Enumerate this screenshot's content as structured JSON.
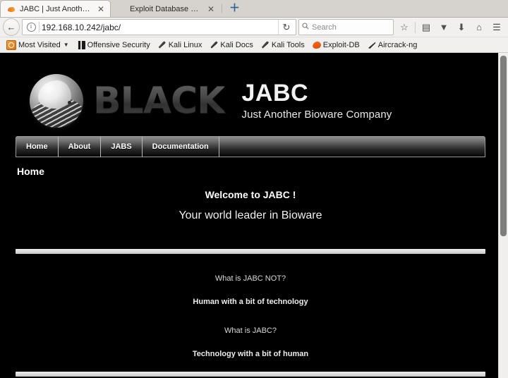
{
  "browser": {
    "tabs": [
      {
        "title": "JABC | Just Another ...",
        "icon": "firefox-globe-icon",
        "active": true,
        "close_label": "✕"
      },
      {
        "title": "Exploit Database Sear...",
        "icon": "exploit-db-icon",
        "active": false,
        "close_label": "✕"
      }
    ],
    "new_tab_label": "＋",
    "back_label": "←",
    "identity_label": "i",
    "url": "192.168.10.242/jabc/",
    "reload_label": "↻",
    "search_placeholder": "Search",
    "search_icon": "🔍",
    "toolbar_icons": [
      {
        "name": "bookmark-star-icon",
        "glyph": "☆"
      },
      {
        "name": "reader-view-icon",
        "glyph": "▤"
      },
      {
        "name": "pocket-icon",
        "glyph": "▼"
      },
      {
        "name": "downloads-icon",
        "glyph": "⬇"
      },
      {
        "name": "home-icon",
        "glyph": "⌂"
      },
      {
        "name": "menu-hamburger-icon",
        "glyph": "☰"
      }
    ],
    "bookmarks": [
      {
        "label": "Most Visited",
        "icon": "most-visited-icon",
        "has_caret": true
      },
      {
        "label": "Offensive Security",
        "icon": "offensive-security-icon",
        "has_caret": false
      },
      {
        "label": "Kali Linux",
        "icon": "kali-dragon-icon",
        "has_caret": false
      },
      {
        "label": "Kali Docs",
        "icon": "kali-dragon-icon",
        "has_caret": false
      },
      {
        "label": "Kali Tools",
        "icon": "kali-dragon-icon",
        "has_caret": false
      },
      {
        "label": "Exploit-DB",
        "icon": "exploit-db-icon",
        "has_caret": false
      },
      {
        "label": "Aircrack-ng",
        "icon": "aircrack-ng-icon",
        "has_caret": false
      }
    ],
    "caret_glyph": "▼"
  },
  "page": {
    "logo_word": "BLACK",
    "site_title": "JABC",
    "site_subtitle": "Just Another Bioware Company",
    "nav": [
      {
        "label": "Home"
      },
      {
        "label": "About"
      },
      {
        "label": "JABS"
      },
      {
        "label": "Documentation"
      }
    ],
    "page_title": "Home",
    "welcome": "Welcome to JABC !",
    "tagline": "Your world leader in Bioware",
    "blocks": [
      {
        "question": "What is JABC NOT?",
        "answer": "Human with a bit of technology"
      },
      {
        "question": "What is JABC?",
        "answer": "Technology with a bit of human"
      }
    ]
  }
}
